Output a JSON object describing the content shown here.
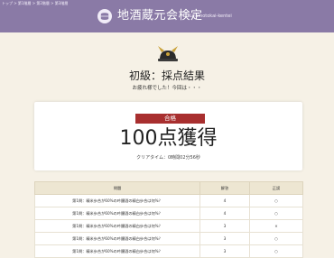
{
  "header": {
    "breadcrumb": "トップ > 第1階層 > 第2階層 > 第3階層",
    "title": "地酒蔵元会検定",
    "subtitle": "Kuramotokai-kentei"
  },
  "result": {
    "title": "初級：採点結果",
    "message": "お疲れ様でした！今回は・・・",
    "badge": "合格",
    "score": "100点獲得",
    "clear_time": "クリアタイム：0時間02分56秒"
  },
  "table": {
    "headers": [
      "問題",
      "解答",
      "正誤"
    ],
    "rows": [
      {
        "question": "第1問：精米歩合が60%の吟醸酒の精白歩合は何%？",
        "answer": "4",
        "mark": "○"
      },
      {
        "question": "第1問：精米歩合が60%の吟醸酒の精白歩合は何%？",
        "answer": "4",
        "mark": "○"
      },
      {
        "question": "第1問：精米歩合が60%の吟醸酒の精白歩合は何%？",
        "answer": "3",
        "mark": "×"
      },
      {
        "question": "第1問：精米歩合が60%の吟醸酒の精白歩合は何%？",
        "answer": "3",
        "mark": "○"
      },
      {
        "question": "第1問：精米歩合が60%の吟醸酒の精白歩合は何%？",
        "answer": "3",
        "mark": "○"
      }
    ]
  },
  "colors": {
    "header_bg": "#8a7aa6",
    "page_bg": "#f6f1e6",
    "badge_bg": "#a82f2f",
    "table_header_bg": "#ede6d2"
  },
  "icons": {
    "logo": "sake-barrel-icon",
    "result": "kabuto-helmet-icon"
  }
}
